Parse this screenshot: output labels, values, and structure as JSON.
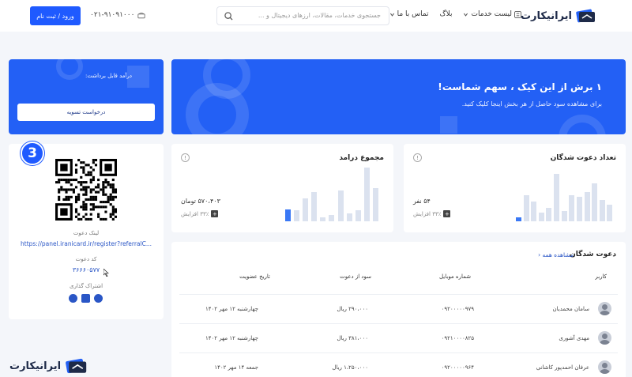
{
  "header": {
    "logo_text": "ایرانیکارت",
    "nav": [
      {
        "label": "لیست خدمات"
      },
      {
        "label": "بلاگ"
      },
      {
        "label": "تماس با ما"
      }
    ],
    "search_placeholder": "جستجوی خدمات، مقالات، ارزهای دیجیتال و ...",
    "phone": "۰۲۱-۹۱۰۹۱۰۰۰",
    "login_label": "ورود / ثبت نام"
  },
  "banner": {
    "title": "۱ برش از این کیک ، سهم شماست!",
    "subtitle": "برای مشاهده سود حاصل از هر بخش اینجا کلیک کنید.",
    "payable_label": "درآمد قابل برداشت:",
    "settle_label": "درخواست تسویه"
  },
  "stats": {
    "invites": {
      "title": "تعداد دعوت شدگان",
      "value": "۵۴ نفر",
      "change": "۳۳٪ افزایش",
      "bars": [
        0.08,
        0.55,
        0.42,
        0.18,
        0.28,
        1.0,
        0.22,
        0.55,
        0.52,
        0.62,
        0.8,
        0.45,
        0.35
      ]
    },
    "income": {
      "title": "مجموع درامد",
      "value": "۵۷۰،۴۰۳ تومان",
      "change": "۳۳٪ افزایش",
      "bars": [
        0.22,
        0.2,
        0.42,
        0.55,
        0.08,
        0.12,
        0.58,
        0.15,
        0.2,
        1.0,
        0.62
      ]
    }
  },
  "referral": {
    "badge": "3",
    "link_label": "لینک دعوت",
    "link": "https://panel.iranicard.ir/register?referralC...",
    "code_label": "کد دعوت",
    "code": "۳۶۶۶۰۵۷۷",
    "share_label": "اشتراک گذاری"
  },
  "table": {
    "title": "دعوت شدگان",
    "view_all": "مشاهده همه",
    "headers": [
      "کاربر",
      "شماره موبایل",
      "سود از دعوت",
      "تاریخ عضویت"
    ],
    "rows": [
      {
        "name": "سامان محمدیان",
        "mobile": "۰۹۲۰۰۰۰۰۹۷۹",
        "profit": "۲۹۰،۰۰۰ ریال",
        "date": "چهارشنبه ۱۲ مهر ۱۴۰۲"
      },
      {
        "name": "مهدی آشوری",
        "mobile": "۰۹۲۱۰۰۰۰۸۲۵",
        "profit": "۳۸۱،۰۰۰ ریال",
        "date": "چهارشنبه ۱۲ مهر ۱۴۰۲"
      },
      {
        "name": "عرفان احمدپور کاشانی",
        "mobile": "۰۹۲۰۰۰۰۰۹۶۴",
        "profit": "۱،۲۵۰،۰۰۰ ریال",
        "date": "جمعه ۱۴ مهر ۱۴۰۲"
      }
    ]
  },
  "watermark": {
    "text": "ایرانیکارت"
  },
  "colors": {
    "primary": "#2360f5",
    "bar_highlight": "#3a78f5",
    "bar_muted": "#dbe2ef"
  }
}
